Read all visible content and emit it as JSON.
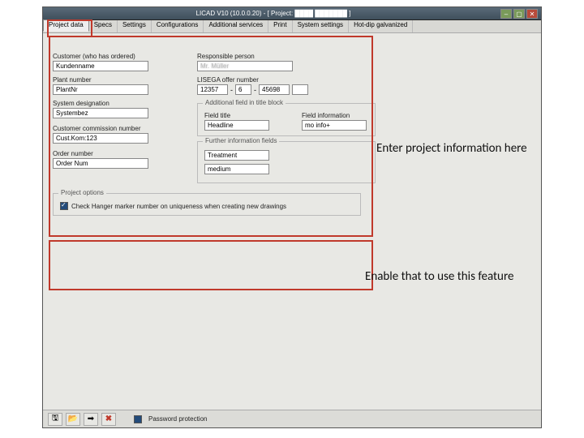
{
  "window": {
    "title": "LICAD V10 (10.0.0.20) - [ Project: ████ ███████ ]"
  },
  "tabs": {
    "project_data": "Project data",
    "specs": "Specs",
    "settings": "Settings",
    "configurations": "Configurations",
    "additional_services": "Additional services",
    "print": "Print",
    "system_settings": "System settings",
    "hot_dip": "Hot-dip galvanized"
  },
  "labels": {
    "customer": "Customer (who has ordered)",
    "responsible": "Responsible person",
    "plant_number": "Plant number",
    "lisega_offer": "LISEGA offer number",
    "system_designation": "System designation",
    "field_title": "Field title",
    "field_information": "Field information",
    "additional_legend": "Additional field in title block",
    "customer_commission": "Customer commission number",
    "further_legend": "Further information fields",
    "order_number": "Order number",
    "project_options_legend": "Project options",
    "check_hanger": "Check Hanger marker number on uniqueness when creating new drawings",
    "password_protection": "Password protection"
  },
  "values": {
    "customer": "Kundenname",
    "responsible": "Mr. Müller",
    "plant_number": "PlantNr",
    "offer_a": "12357",
    "offer_b": "6",
    "offer_c": "45698",
    "offer_d": "",
    "system_designation": "Systembez",
    "field_title": "Headline",
    "field_information": "mo info+",
    "customer_commission": "Cust.Kom:123",
    "further1": "Treatment",
    "further2": "medium",
    "order_number": "Order Num"
  },
  "annotations": {
    "callout1": "Enter project information here",
    "callout2": "Enable that to use this feature"
  },
  "icons": {
    "save": "🖫",
    "open": "📂",
    "export": "➡",
    "cancel": "✖"
  }
}
